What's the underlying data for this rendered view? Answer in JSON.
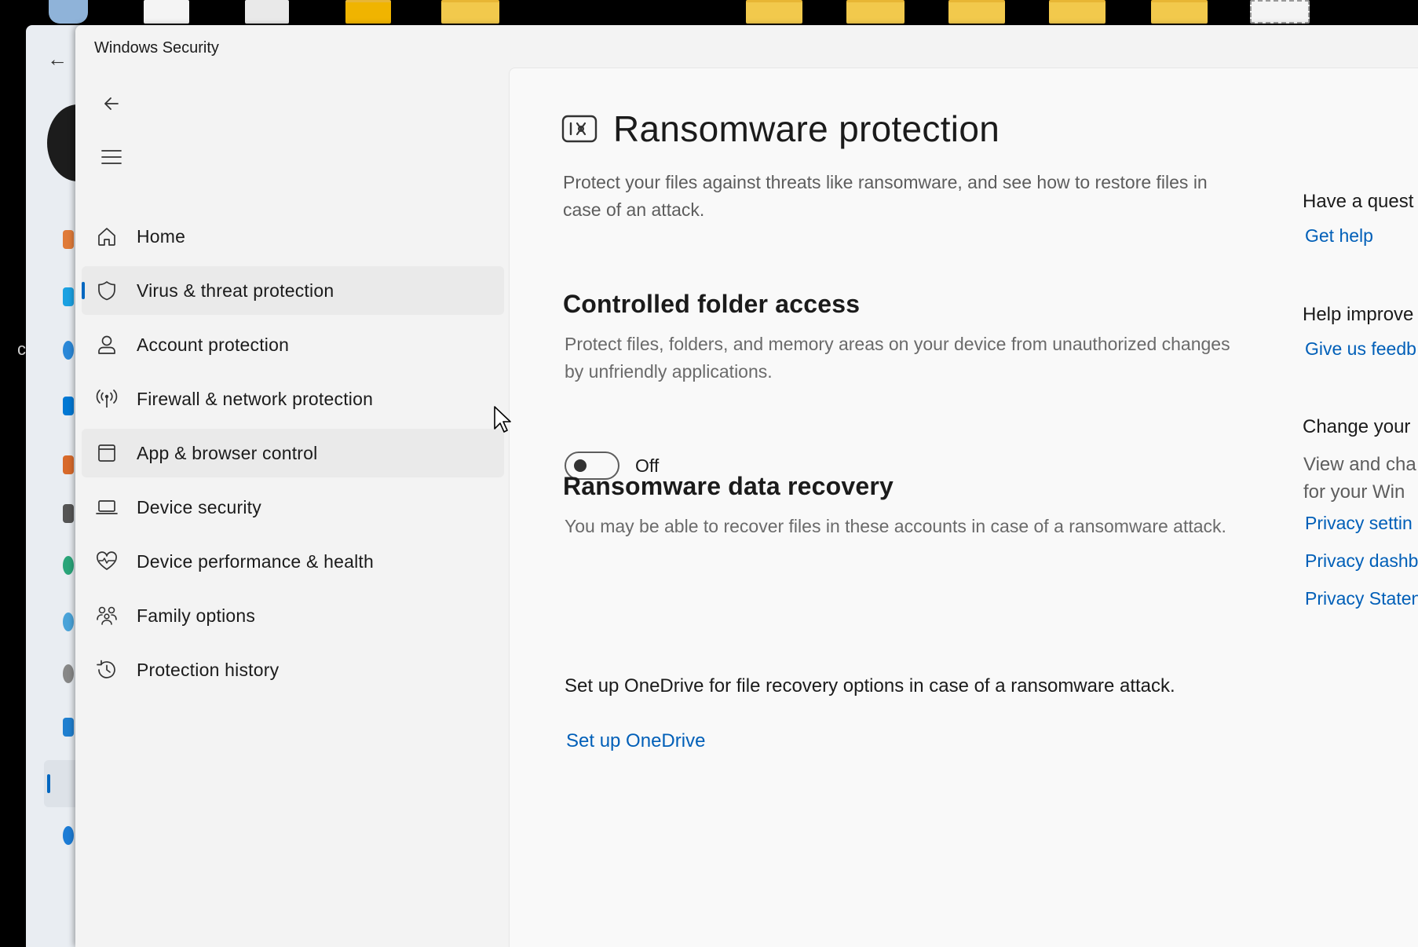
{
  "window": {
    "title": "Windows Security"
  },
  "nav": {
    "back_icon": "back-arrow-icon",
    "menu_icon": "hamburger-menu-icon",
    "items": [
      {
        "label": "Home",
        "icon": "home-icon"
      },
      {
        "label": "Virus & threat protection",
        "icon": "shield-icon",
        "selected": true
      },
      {
        "label": "Account protection",
        "icon": "person-icon"
      },
      {
        "label": "Firewall & network protection",
        "icon": "antenna-icon"
      },
      {
        "label": "App & browser control",
        "icon": "app-window-icon"
      },
      {
        "label": "Device security",
        "icon": "laptop-icon"
      },
      {
        "label": "Device performance & health",
        "icon": "heart-pulse-icon"
      },
      {
        "label": "Family options",
        "icon": "family-icon"
      },
      {
        "label": "Protection history",
        "icon": "history-icon"
      }
    ]
  },
  "page": {
    "title": "Ransomware protection",
    "icon": "ransomware-icon",
    "description": "Protect your files against threats like ransomware, and see how to restore files in case of an attack."
  },
  "cfa": {
    "title": "Controlled folder access",
    "description": "Protect files, folders, and memory areas on your device from unauthorized changes by unfriendly applications.",
    "toggle_state": "Off"
  },
  "recovery": {
    "title": "Ransomware data recovery",
    "description": "You may be able to recover files in these accounts in case of a ransomware attack.",
    "onedrive_text": "Set up OneDrive for file recovery options in case of a ransomware attack.",
    "onedrive_link": "Set up OneDrive"
  },
  "side": {
    "question_title": "Have a quest",
    "get_help": "Get help",
    "improve_title": "Help improve",
    "feedback": "Give us feedb",
    "privacy_title": "Change your",
    "privacy_desc_1": "View and cha",
    "privacy_desc_2": "for your Win",
    "privacy_settings": "Privacy settin",
    "privacy_dashboard": "Privacy dashb",
    "privacy_statement": "Privacy Staten"
  },
  "colors": {
    "accent": "#0067c0",
    "link": "#005fb8"
  }
}
